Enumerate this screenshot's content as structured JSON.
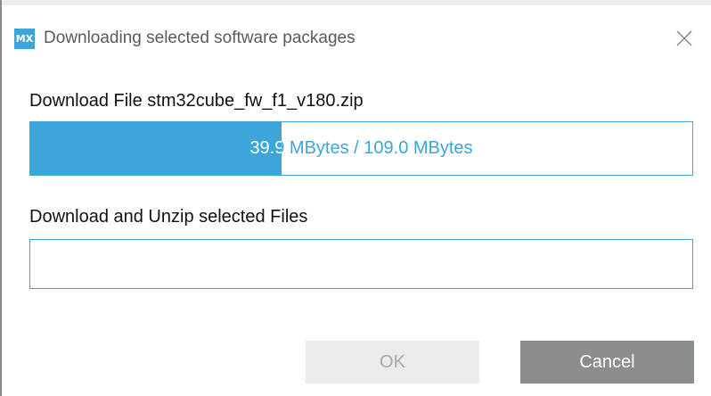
{
  "dialog": {
    "app_icon_text": "MX",
    "title": "Downloading selected software packages",
    "close_icon": "close-icon"
  },
  "download": {
    "label": "Download File stm32cube_fw_f1_v180.zip",
    "progress_text": "39.9 MBytes / 109.0 MBytes",
    "downloaded_mb": 39.9,
    "total_mb": 109.0,
    "progress_fraction": 0.38
  },
  "unzip": {
    "label": "Download and Unzip selected Files",
    "progress_fraction": 0.0
  },
  "buttons": {
    "ok_label": "OK",
    "cancel_label": "Cancel"
  },
  "colors": {
    "accent": "#3da5d9",
    "cancel_bg": "#8a8e91",
    "ok_disabled_bg": "#ebebeb"
  }
}
